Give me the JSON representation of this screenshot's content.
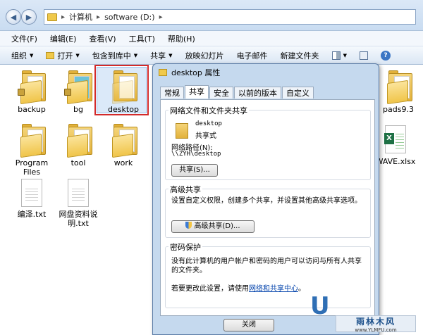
{
  "address": {
    "crumbs": [
      "计算机",
      "software (D:)"
    ]
  },
  "menu": [
    "文件(F)",
    "编辑(E)",
    "查看(V)",
    "工具(T)",
    "帮助(H)"
  ],
  "toolbar": {
    "organize": "组织",
    "open": "打开",
    "include": "包含到库中",
    "share": "共享",
    "slideshow": "放映幻灯片",
    "email": "电子邮件",
    "newfolder": "新建文件夹"
  },
  "files": {
    "backup": "backup",
    "bg": "bg",
    "desktop": "desktop",
    "pads": "pads9.3",
    "program_files": "Program Files",
    "tool": "tool",
    "work": "work",
    "wave": "WAVE.xlsx",
    "bianyi": "编泽.txt",
    "wangpan": "网盘资料说明.txt"
  },
  "dialog": {
    "title": "desktop 属性",
    "tabs": [
      "常规",
      "共享",
      "安全",
      "以前的版本",
      "自定义"
    ],
    "share_group": {
      "title": "网络文件和文件夹共享",
      "name": "desktop",
      "status": "共享式",
      "path_label": "网络路径(N):",
      "path": "\\\\ZYH\\desktop",
      "button": "共享(S)..."
    },
    "advanced_group": {
      "title": "高级共享",
      "desc": "设置自定义权限，创建多个共享，并设置其他高级共享选项。",
      "button": "高级共享(D)..."
    },
    "password_group": {
      "title": "密码保护",
      "desc": "没有此计算机的用户帐户和密码的用户可以访问与所有人共享的文件夹。",
      "change_prefix": "若要更改此设置，请使用",
      "link": "网络和共享中心",
      "change_suffix": "。"
    },
    "close_button": "关闭"
  },
  "watermark": {
    "logo": "雨林木风",
    "url": "www.YLMFU.com",
    "letter": "U"
  }
}
